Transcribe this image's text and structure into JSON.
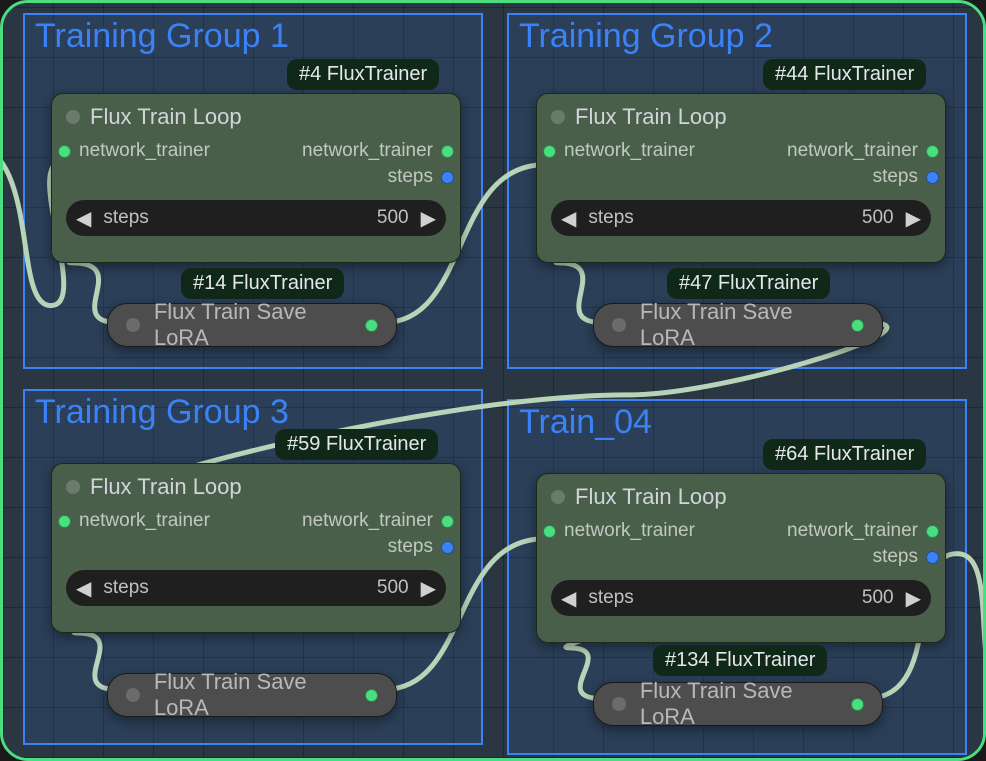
{
  "groups": [
    {
      "title": "Training Group 1"
    },
    {
      "title": "Training Group 2"
    },
    {
      "title": "Training Group 3"
    },
    {
      "title": "Train_04"
    }
  ],
  "badges": {
    "loop1": "#4 FluxTrainer",
    "save1": "#14 FluxTrainer",
    "loop2": "#44 FluxTrainer",
    "save2": "#47 FluxTrainer",
    "loop3": "#59 FluxTrainer",
    "save3": null,
    "loop4": "#64 FluxTrainer",
    "save4": "#134 FluxTrainer"
  },
  "node": {
    "loop_title": "Flux Train Loop",
    "save_title": "Flux Train Save LoRA",
    "input_label": "network_trainer",
    "output_trainer": "network_trainer",
    "output_steps": "steps",
    "widget_label": "steps",
    "widget_value": "500"
  }
}
